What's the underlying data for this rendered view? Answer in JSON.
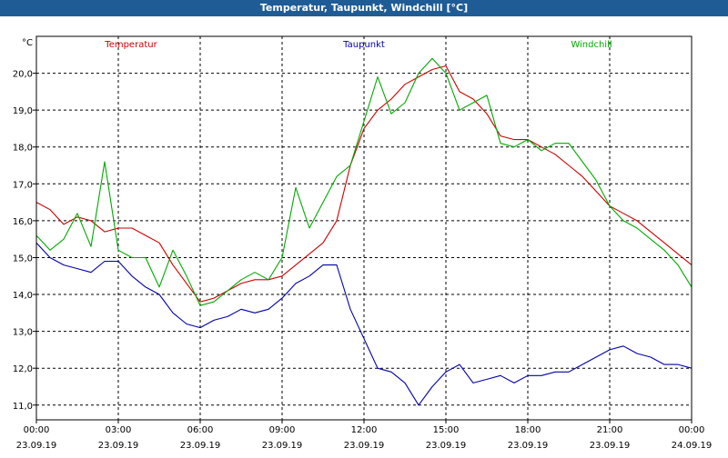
{
  "window": {
    "title": "Temperatur, Taupunkt, Windchill [°C]"
  },
  "chart_data": {
    "type": "line",
    "title": "Temperatur, Taupunkt, Windchill [°C]",
    "ylabel": "°C",
    "xlabel": "",
    "ylim": [
      10.6,
      21.0
    ],
    "xlim": [
      0,
      24
    ],
    "x_unit": "hours since 23.09.19 00:00",
    "grid": true,
    "legend": "top, inline",
    "yticks": [
      "11,0",
      "12,0",
      "13,0",
      "14,0",
      "15,0",
      "16,0",
      "17,0",
      "18,0",
      "19,0",
      "20,0"
    ],
    "ytick_values": [
      11,
      12,
      13,
      14,
      15,
      16,
      17,
      18,
      19,
      20
    ],
    "xticks": [
      {
        "time": "00:00",
        "date": "23.09.19"
      },
      {
        "time": "03:00",
        "date": "23.09.19"
      },
      {
        "time": "06:00",
        "date": "23.09.19"
      },
      {
        "time": "09:00",
        "date": "23.09.19"
      },
      {
        "time": "12:00",
        "date": "23.09.19"
      },
      {
        "time": "15:00",
        "date": "23.09.19"
      },
      {
        "time": "18:00",
        "date": "23.09.19"
      },
      {
        "time": "21:00",
        "date": "23.09.19"
      },
      {
        "time": "00:00",
        "date": "24.09.19"
      }
    ],
    "series": [
      {
        "name": "Temperatur",
        "color": "#cc0000",
        "x": [
          0,
          0.5,
          1,
          1.5,
          2,
          2.5,
          3,
          3.5,
          4,
          4.5,
          5,
          5.5,
          6,
          6.5,
          7,
          7.5,
          8,
          8.5,
          9,
          9.5,
          10,
          10.5,
          11,
          11.5,
          12,
          12.5,
          13,
          13.5,
          14,
          14.5,
          15,
          15.5,
          16,
          16.5,
          17,
          17.5,
          18,
          18.5,
          19,
          19.5,
          20,
          20.5,
          21,
          21.5,
          22,
          22.5,
          23,
          23.5,
          24
        ],
        "values": [
          16.5,
          16.3,
          15.9,
          16.1,
          16.0,
          15.7,
          15.8,
          15.8,
          15.6,
          15.4,
          14.8,
          14.3,
          13.8,
          13.9,
          14.1,
          14.3,
          14.4,
          14.4,
          14.5,
          14.8,
          15.1,
          15.4,
          16.0,
          17.5,
          18.5,
          19.0,
          19.3,
          19.7,
          19.9,
          20.1,
          20.2,
          19.5,
          19.3,
          18.9,
          18.3,
          18.2,
          18.2,
          18.0,
          17.8,
          17.5,
          17.2,
          16.8,
          16.4,
          16.2,
          16.0,
          15.7,
          15.4,
          15.1,
          14.8
        ]
      },
      {
        "name": "Taupunkt",
        "color": "#0000aa",
        "x": [
          0,
          0.5,
          1,
          1.5,
          2,
          2.5,
          3,
          3.5,
          4,
          4.5,
          5,
          5.5,
          6,
          6.5,
          7,
          7.5,
          8,
          8.5,
          9,
          9.5,
          10,
          10.5,
          11,
          11.5,
          12,
          12.5,
          13,
          13.5,
          14,
          14.5,
          15,
          15.5,
          16,
          16.5,
          17,
          17.5,
          18,
          18.5,
          19,
          19.5,
          20,
          20.5,
          21,
          21.5,
          22,
          22.5,
          23,
          23.5,
          24
        ],
        "values": [
          15.4,
          15.0,
          14.8,
          14.7,
          14.6,
          14.9,
          14.9,
          14.5,
          14.2,
          14.0,
          13.5,
          13.2,
          13.1,
          13.3,
          13.4,
          13.6,
          13.5,
          13.6,
          13.9,
          14.3,
          14.5,
          14.8,
          14.8,
          13.6,
          12.8,
          12.0,
          11.9,
          11.6,
          11.0,
          11.5,
          11.9,
          12.1,
          11.6,
          11.7,
          11.8,
          11.6,
          11.8,
          11.8,
          11.9,
          11.9,
          12.1,
          12.3,
          12.5,
          12.6,
          12.4,
          12.3,
          12.1,
          12.1,
          12.0
        ]
      },
      {
        "name": "Windchill",
        "color": "#00aa00",
        "x": [
          0,
          0.5,
          1,
          1.5,
          2,
          2.5,
          3,
          3.5,
          4,
          4.5,
          5,
          5.5,
          6,
          6.5,
          7,
          7.5,
          8,
          8.5,
          9,
          9.5,
          10,
          10.5,
          11,
          11.5,
          12,
          12.5,
          13,
          13.5,
          14,
          14.5,
          15,
          15.5,
          16,
          16.5,
          17,
          17.5,
          18,
          18.5,
          19,
          19.5,
          20,
          20.5,
          21,
          21.5,
          22,
          22.5,
          23,
          23.5,
          24
        ],
        "values": [
          15.6,
          15.2,
          15.5,
          16.2,
          15.3,
          17.6,
          15.2,
          15.0,
          15.0,
          14.2,
          15.2,
          14.5,
          13.7,
          13.8,
          14.1,
          14.4,
          14.6,
          14.4,
          15.0,
          16.9,
          15.8,
          16.5,
          17.2,
          17.5,
          18.7,
          19.9,
          18.9,
          19.2,
          20.0,
          20.4,
          20.0,
          19.0,
          19.2,
          19.4,
          18.1,
          18.0,
          18.2,
          17.9,
          18.1,
          18.1,
          17.6,
          17.1,
          16.4,
          16.0,
          15.8,
          15.5,
          15.2,
          14.8,
          14.2
        ]
      }
    ]
  }
}
